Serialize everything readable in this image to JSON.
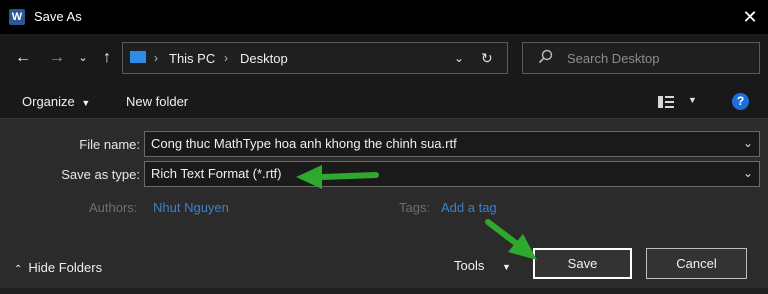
{
  "window": {
    "title": "Save As",
    "app_icon_letter": "W"
  },
  "nav": {
    "breadcrumbs": [
      "This PC",
      "Desktop"
    ],
    "search_placeholder": "Search Desktop"
  },
  "toolbar": {
    "organize": "Organize",
    "new_folder": "New folder",
    "help": "?"
  },
  "form": {
    "file_name_label": "File name:",
    "file_name_value": "Cong thuc MathType hoa anh khong the chinh sua.rtf",
    "save_type_label": "Save as type:",
    "save_type_value": "Rich Text Format (*.rtf)",
    "authors_label": "Authors:",
    "authors_value": "Nhut Nguyen",
    "tags_label": "Tags:",
    "tags_value": "Add a tag"
  },
  "footer": {
    "hide_folders": "Hide Folders",
    "tools": "Tools",
    "save": "Save",
    "cancel": "Cancel"
  },
  "colors": {
    "annotation_arrow": "#2fa82f",
    "accent": "#1e6fd9",
    "link": "#3c7fd1"
  },
  "icons": [
    "word-app-icon",
    "close-icon",
    "back-arrow-icon",
    "forward-arrow-icon",
    "chevron-down-icon",
    "up-arrow-icon",
    "this-pc-icon",
    "dropdown-icon",
    "refresh-icon",
    "search-icon",
    "view-icon",
    "help-icon"
  ]
}
